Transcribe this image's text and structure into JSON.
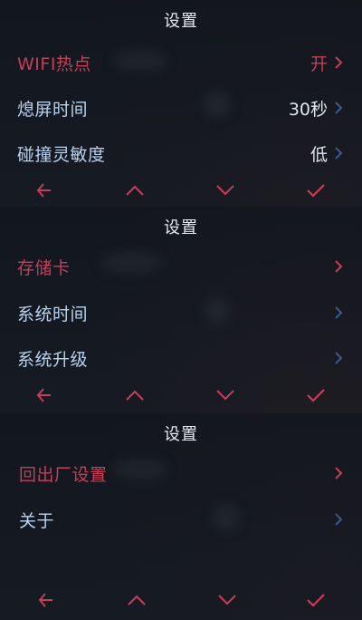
{
  "panels": [
    {
      "title": "设置",
      "items": [
        {
          "label": "WIFI热点",
          "value": "开"
        },
        {
          "label": "熄屏时间",
          "value": "30秒"
        },
        {
          "label": "碰撞灵敏度",
          "value": "低"
        }
      ]
    },
    {
      "title": "设置",
      "items": [
        {
          "label": "存储卡",
          "value": ""
        },
        {
          "label": "系统时间",
          "value": ""
        },
        {
          "label": "系统升级",
          "value": ""
        }
      ]
    },
    {
      "title": "设置",
      "items": [
        {
          "label": "回出厂设置",
          "value": ""
        },
        {
          "label": "关于",
          "value": ""
        }
      ]
    }
  ],
  "nav_icons": [
    "back-arrow-icon",
    "up-chevron-icon",
    "down-chevron-icon",
    "confirm-check-icon"
  ],
  "colors": {
    "accent": "#c83e58",
    "label": "#b9d3ef",
    "chevron": "#3c5a8c",
    "title": "#e6eaf0"
  }
}
